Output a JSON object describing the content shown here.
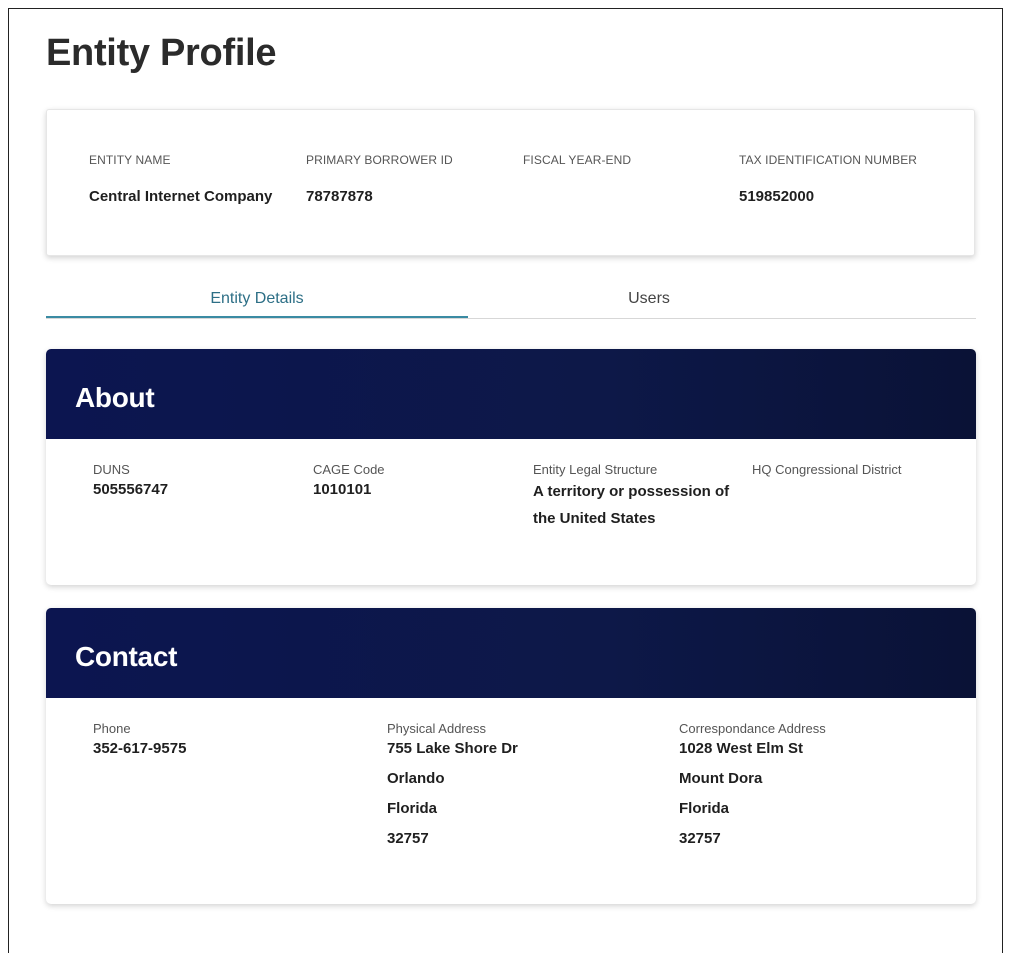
{
  "page": {
    "title": "Entity Profile"
  },
  "summary": {
    "columns": [
      {
        "label": "ENTITY NAME",
        "value": "Central Internet Company"
      },
      {
        "label": "PRIMARY BORROWER ID",
        "value": "78787878"
      },
      {
        "label": "FISCAL YEAR-END",
        "value": ""
      },
      {
        "label": "TAX IDENTIFICATION NUMBER",
        "value": "519852000"
      }
    ]
  },
  "tabs": [
    {
      "label": "Entity Details",
      "active": true
    },
    {
      "label": "Users",
      "active": false
    }
  ],
  "about": {
    "title": "About",
    "fields": [
      {
        "label": "DUNS",
        "value": "505556747"
      },
      {
        "label": "CAGE Code",
        "value": "1010101"
      },
      {
        "label": "Entity Legal Structure",
        "lines": [
          "A territory or possession of",
          "the United States"
        ]
      },
      {
        "label": "HQ Congressional District",
        "value": ""
      }
    ]
  },
  "contact": {
    "title": "Contact",
    "phone": {
      "label": "Phone",
      "value": "352-617-9575"
    },
    "physical_address": {
      "label": "Physical Address",
      "lines": [
        "755 Lake Shore Dr",
        "Orlando",
        "Florida",
        "32757"
      ]
    },
    "correspondence_address": {
      "label": "Correspondance Address",
      "lines": [
        "1028 West Elm St",
        "Mount Dora",
        "Florida",
        "32757"
      ]
    }
  },
  "colors": {
    "header_navy": "#0c1550",
    "tab_active": "#3a8ba3",
    "tab_active_text": "#2d6f86"
  }
}
